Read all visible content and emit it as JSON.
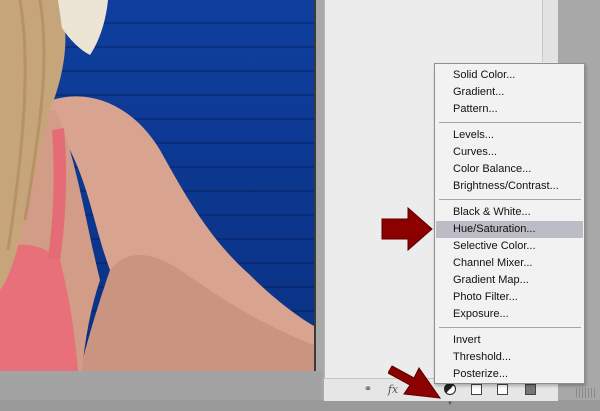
{
  "photo": {
    "wall_color": "#0c3891",
    "skin_color": "#d9a58e",
    "swimsuit_color": "#e8707a",
    "hair_color": "#c9a77a"
  },
  "adjustment_menu": {
    "groups": [
      [
        "Solid Color...",
        "Gradient...",
        "Pattern..."
      ],
      [
        "Levels...",
        "Curves...",
        "Color Balance...",
        "Brightness/Contrast..."
      ],
      [
        "Black & White...",
        "Hue/Saturation...",
        "Selective Color...",
        "Channel Mixer...",
        "Gradient Map...",
        "Photo Filter...",
        "Exposure..."
      ],
      [
        "Invert",
        "Threshold...",
        "Posterize..."
      ]
    ],
    "highlighted_item": "Hue/Saturation...",
    "highlight_color": "#bcbcc6"
  },
  "layers_toolbar": {
    "buttons": [
      {
        "name": "link-layers",
        "icon": "chain-link-icon",
        "glyph": "⚭"
      },
      {
        "name": "layer-style",
        "icon": "fx-icon",
        "glyph": "fx"
      },
      {
        "name": "add-mask",
        "icon": "mask-icon"
      },
      {
        "name": "new-adjustment-layer",
        "icon": "half-circle-icon"
      },
      {
        "name": "new-group",
        "icon": "folder-icon"
      },
      {
        "name": "new-layer",
        "icon": "new-layer-icon"
      },
      {
        "name": "delete-layer",
        "icon": "trash-icon"
      }
    ]
  },
  "annotations": {
    "arrow_color": "#8c0000"
  }
}
